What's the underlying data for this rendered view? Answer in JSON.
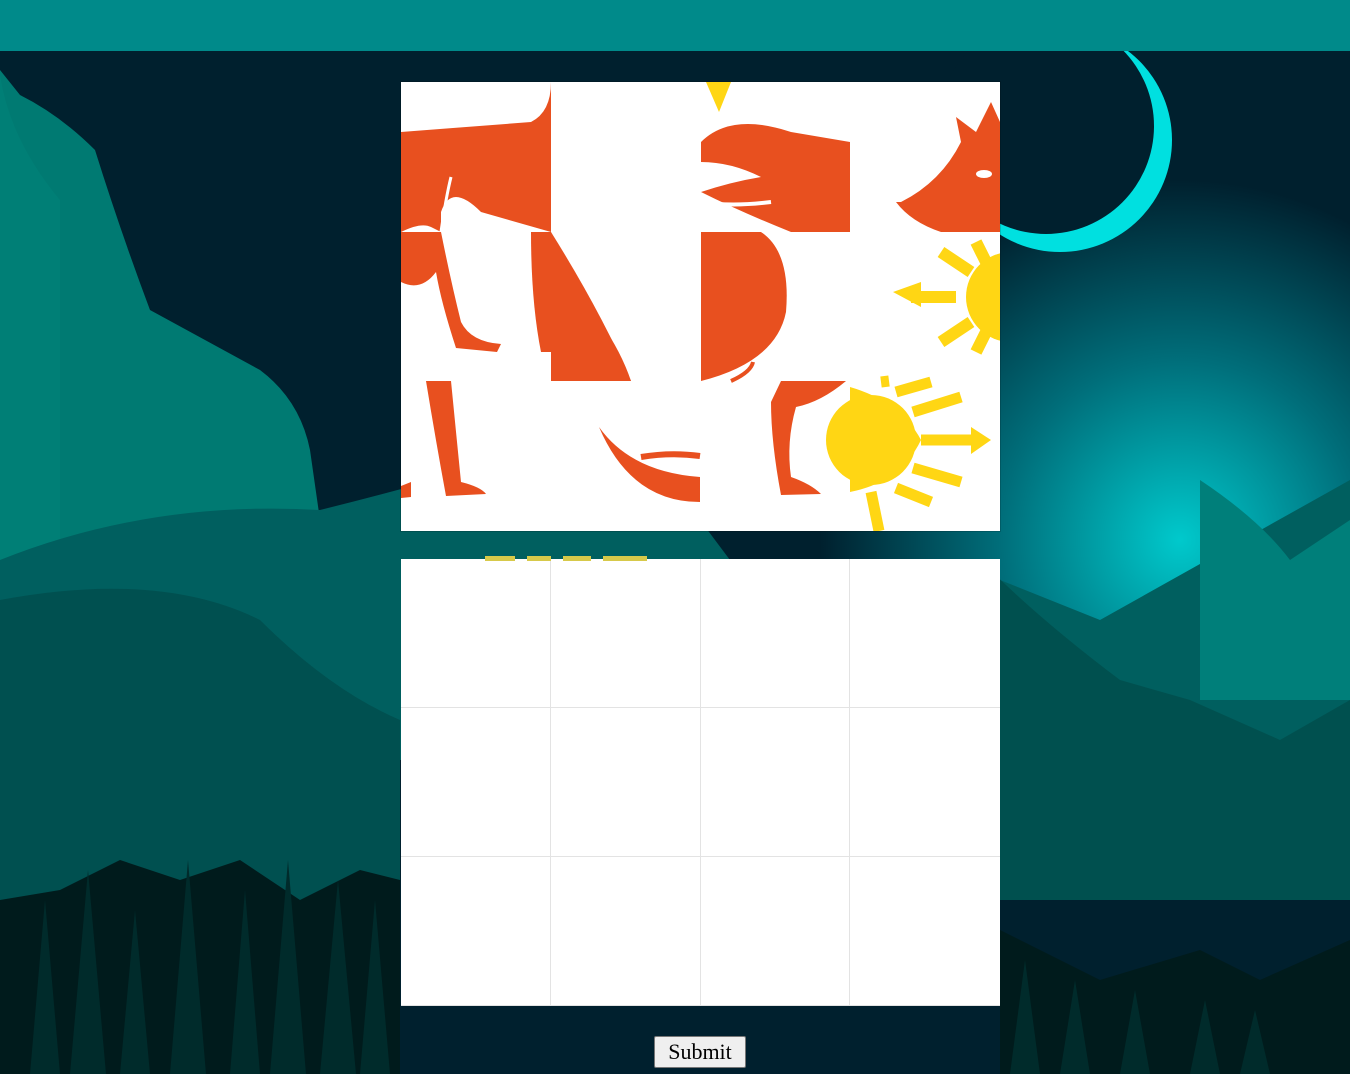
{
  "submit_label": "Submit",
  "colors": {
    "topbar": "#008a8a",
    "sky": "#00202e",
    "fox": "#e8501f",
    "sun": "#ffd614",
    "moon_glow": "#00e3e3"
  },
  "pieces": [
    {
      "position": 1,
      "depicts": "fox-hind-leg"
    },
    {
      "position": 2,
      "depicts": "fox-belly-curve"
    },
    {
      "position": 3,
      "depicts": "fox-tail-tip"
    },
    {
      "position": 4,
      "depicts": "fox-head"
    },
    {
      "position": 5,
      "depicts": "fox-hind-legs"
    },
    {
      "position": 6,
      "depicts": "fox-body"
    },
    {
      "position": 7,
      "depicts": "fox-chest"
    },
    {
      "position": 8,
      "depicts": "sun-left"
    },
    {
      "position": 9,
      "depicts": "fox-foot"
    },
    {
      "position": 10,
      "depicts": "fox-tail"
    },
    {
      "position": 11,
      "depicts": "fox-front-leg"
    },
    {
      "position": 12,
      "depicts": "sun-center"
    }
  ],
  "drop_slots": 12
}
